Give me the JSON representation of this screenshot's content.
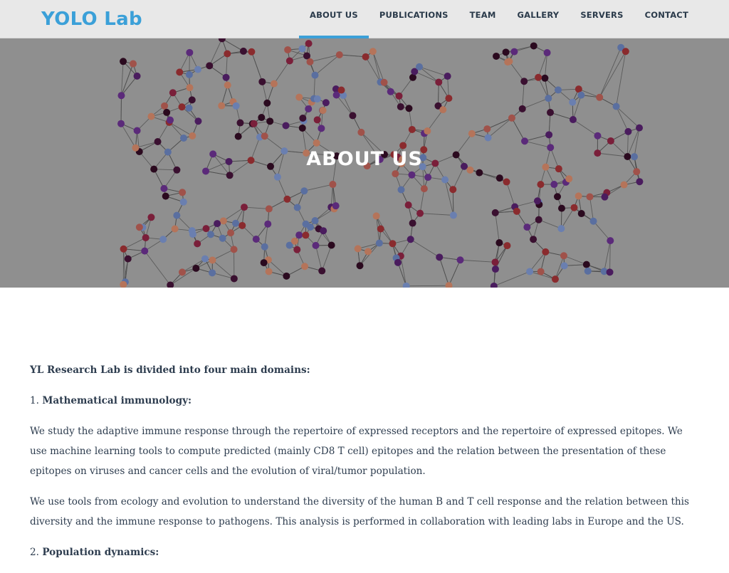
{
  "header": {
    "brand": "YOLO Lab",
    "nav": [
      {
        "label": "ABOUT US",
        "active": true
      },
      {
        "label": "PUBLICATIONS",
        "active": false
      },
      {
        "label": "TEAM",
        "active": false
      },
      {
        "label": "GALLERY",
        "active": false
      },
      {
        "label": "SERVERS",
        "active": false
      },
      {
        "label": "CONTACT",
        "active": false
      }
    ]
  },
  "hero": {
    "title": "ABOUT US"
  },
  "content": {
    "intro": "YL Research Lab is divided into four main domains:",
    "domain1_number": "1.",
    "domain1_title": "Mathematical immunology:",
    "paragraph1": "We study the adaptive immune response through the repertoire of expressed receptors and the repertoire of expressed epitopes. We use machine learning tools to compute predicted (mainly CD8 T cell) epitopes and the relation between the presentation of these epitopes on viruses and cancer cells and the evolution of viral/tumor population.",
    "paragraph2": "We use tools from ecology and evolution to understand the diversity of the human B and T cell response and the relation between this diversity and the immune response to pathogens. This analysis is performed in collaboration with leading labs in Europe and the US.",
    "domain2_number": "2.",
    "domain2_title": "Population dynamics:"
  },
  "colors": {
    "accent": "#3ba0d8",
    "nav_bg": "#e8e8e8",
    "hero_bg": "#8f8f8f",
    "text": "#2e3d4f"
  }
}
